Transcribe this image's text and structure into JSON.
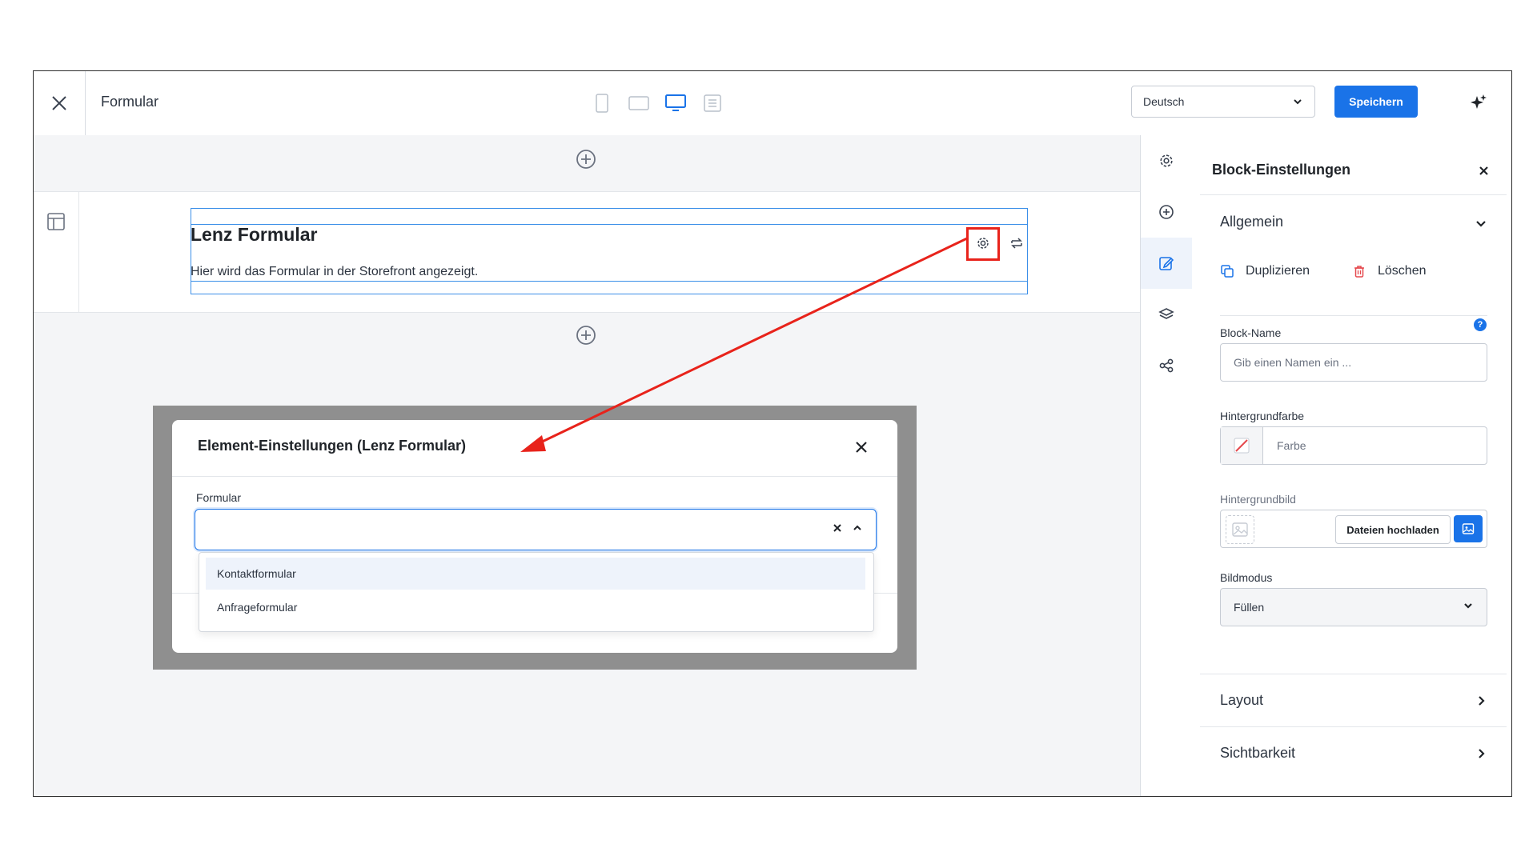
{
  "topbar": {
    "page_title": "Formular",
    "language": "Deutsch",
    "save_label": "Speichern"
  },
  "block": {
    "heading": "Lenz Formular",
    "text": "Hier wird das Formular in der Storefront angezeigt."
  },
  "modal": {
    "title": "Element-Einstellungen (Lenz Formular)",
    "field_label": "Formular",
    "options": [
      "Kontaktformular",
      "Anfrageformular"
    ]
  },
  "panel": {
    "title": "Block-Einstellungen",
    "general_section": "Allgemein",
    "duplicate_label": "Duplizieren",
    "delete_label": "Löschen",
    "block_name_label": "Block-Name",
    "block_name_placeholder": "Gib einen Namen ein ...",
    "bg_color_label": "Hintergrundfarbe",
    "bg_color_placeholder": "Farbe",
    "bg_image_label": "Hintergrundbild",
    "upload_label": "Dateien hochladen",
    "image_mode_label": "Bildmodus",
    "image_mode_value": "Füllen",
    "layout_section": "Layout",
    "visibility_section": "Sichtbarkeit",
    "help_mark": "?"
  },
  "colors": {
    "accent": "#1a73e8",
    "highlight": "#e8231b",
    "delete": "#e5484d"
  }
}
